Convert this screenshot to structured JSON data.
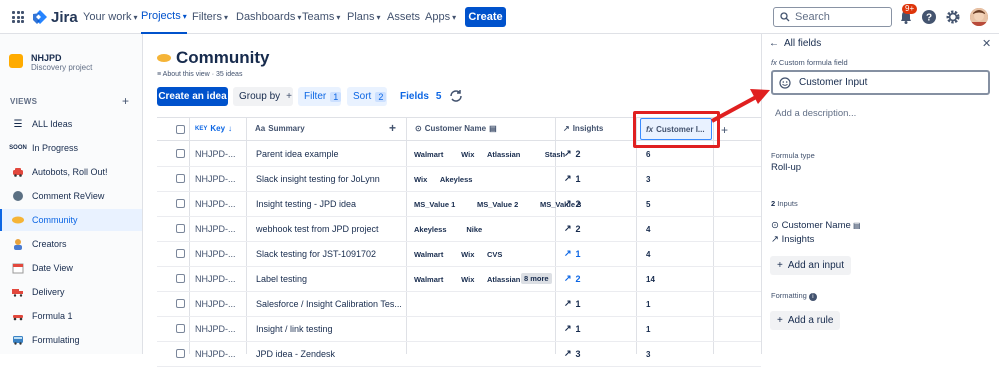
{
  "topbar": {
    "logo": "Jira",
    "nav": [
      "Your work",
      "Projects",
      "Filters",
      "Dashboards",
      "Teams",
      "Plans",
      "Assets",
      "Apps"
    ],
    "create": "Create",
    "search_placeholder": "Search",
    "notif_count": "9+"
  },
  "sidebar": {
    "project_name": "NHJPD",
    "project_type": "Discovery project",
    "views_heading": "VIEWS",
    "items": [
      {
        "label": "ALL Ideas",
        "icon": "list-icon"
      },
      {
        "label": "In Progress",
        "icon": "soon-icon"
      },
      {
        "label": "Autobots, Roll Out!",
        "icon": "car-icon"
      },
      {
        "label": "Comment ReView",
        "icon": "speech-head-icon"
      },
      {
        "label": "Community",
        "icon": "handshake-icon"
      },
      {
        "label": "Creators",
        "icon": "person-icon"
      },
      {
        "label": "Date View",
        "icon": "calendar-icon"
      },
      {
        "label": "Delivery",
        "icon": "truck-icon"
      },
      {
        "label": "Formula 1",
        "icon": "race-car-icon"
      },
      {
        "label": "Formulating",
        "icon": "bus-icon"
      }
    ]
  },
  "main": {
    "title": "Community",
    "about": "About this view",
    "idea_count": "35 ideas",
    "toolbar": {
      "create_idea": "Create an idea",
      "group_by": "Group by",
      "filter": "Filter",
      "filter_count": "1",
      "sort": "Sort",
      "sort_count": "2",
      "fields": "Fields",
      "fields_count": "5"
    },
    "columns": {
      "key": "Key",
      "summary": "Summary",
      "customer_name": "Customer Name",
      "insights": "Insights",
      "customer_input": "Customer I..."
    },
    "rows": [
      {
        "key": "NHJPD-...",
        "summary": "Parent idea example",
        "customers": [
          "Walmart",
          "Wix",
          "Atlassian",
          "Stash"
        ],
        "insights": "2",
        "insights_blue": false,
        "customer_input": "6"
      },
      {
        "key": "NHJPD-...",
        "summary": "Slack insight testing for JoLynn",
        "customers": [
          "Wix",
          "Akeyless"
        ],
        "insights": "1",
        "insights_blue": false,
        "customer_input": "3"
      },
      {
        "key": "NHJPD-...",
        "summary": "Insight testing - JPD idea",
        "customers": [
          "MS_Value 1",
          "MS_Value 2",
          "MS_Value 3"
        ],
        "insights": "2",
        "insights_blue": false,
        "customer_input": "5"
      },
      {
        "key": "NHJPD-...",
        "summary": "webhook test from JPD project",
        "customers": [
          "Akeyless",
          "Nike"
        ],
        "insights": "2",
        "insights_blue": false,
        "customer_input": "4"
      },
      {
        "key": "NHJPD-...",
        "summary": "Slack testing for JST-1091702",
        "customers": [
          "Walmart",
          "Wix",
          "CVS"
        ],
        "insights": "1",
        "insights_blue": true,
        "customer_input": "4"
      },
      {
        "key": "NHJPD-...",
        "summary": "Label testing",
        "customers": [
          "Walmart",
          "Wix",
          "Atlassian"
        ],
        "more": "8 more",
        "insights": "2",
        "insights_blue": true,
        "customer_input": "14"
      },
      {
        "key": "NHJPD-...",
        "summary": "Salesforce / Insight Calibration Tes...",
        "customers": [],
        "insights": "1",
        "insights_blue": false,
        "customer_input": "1"
      },
      {
        "key": "NHJPD-...",
        "summary": "Insight / link testing",
        "customers": [],
        "insights": "1",
        "insights_blue": false,
        "customer_input": "1"
      },
      {
        "key": "NHJPD-...",
        "summary": "JPD idea - Zendesk",
        "customers": [],
        "insights": "3",
        "insights_blue": false,
        "customer_input": "3"
      }
    ]
  },
  "panel": {
    "back": "All fields",
    "field_type": "Custom formula field",
    "field_name": "Customer Input",
    "description_placeholder": "Add a description...",
    "formula_type_label": "Formula type",
    "formula_type": "Roll-up",
    "inputs_count": "2",
    "inputs_label": "Inputs",
    "inputs": [
      "Customer Name",
      "Insights"
    ],
    "add_input": "Add an input",
    "formatting_label": "Formatting",
    "add_rule": "Add a rule"
  }
}
